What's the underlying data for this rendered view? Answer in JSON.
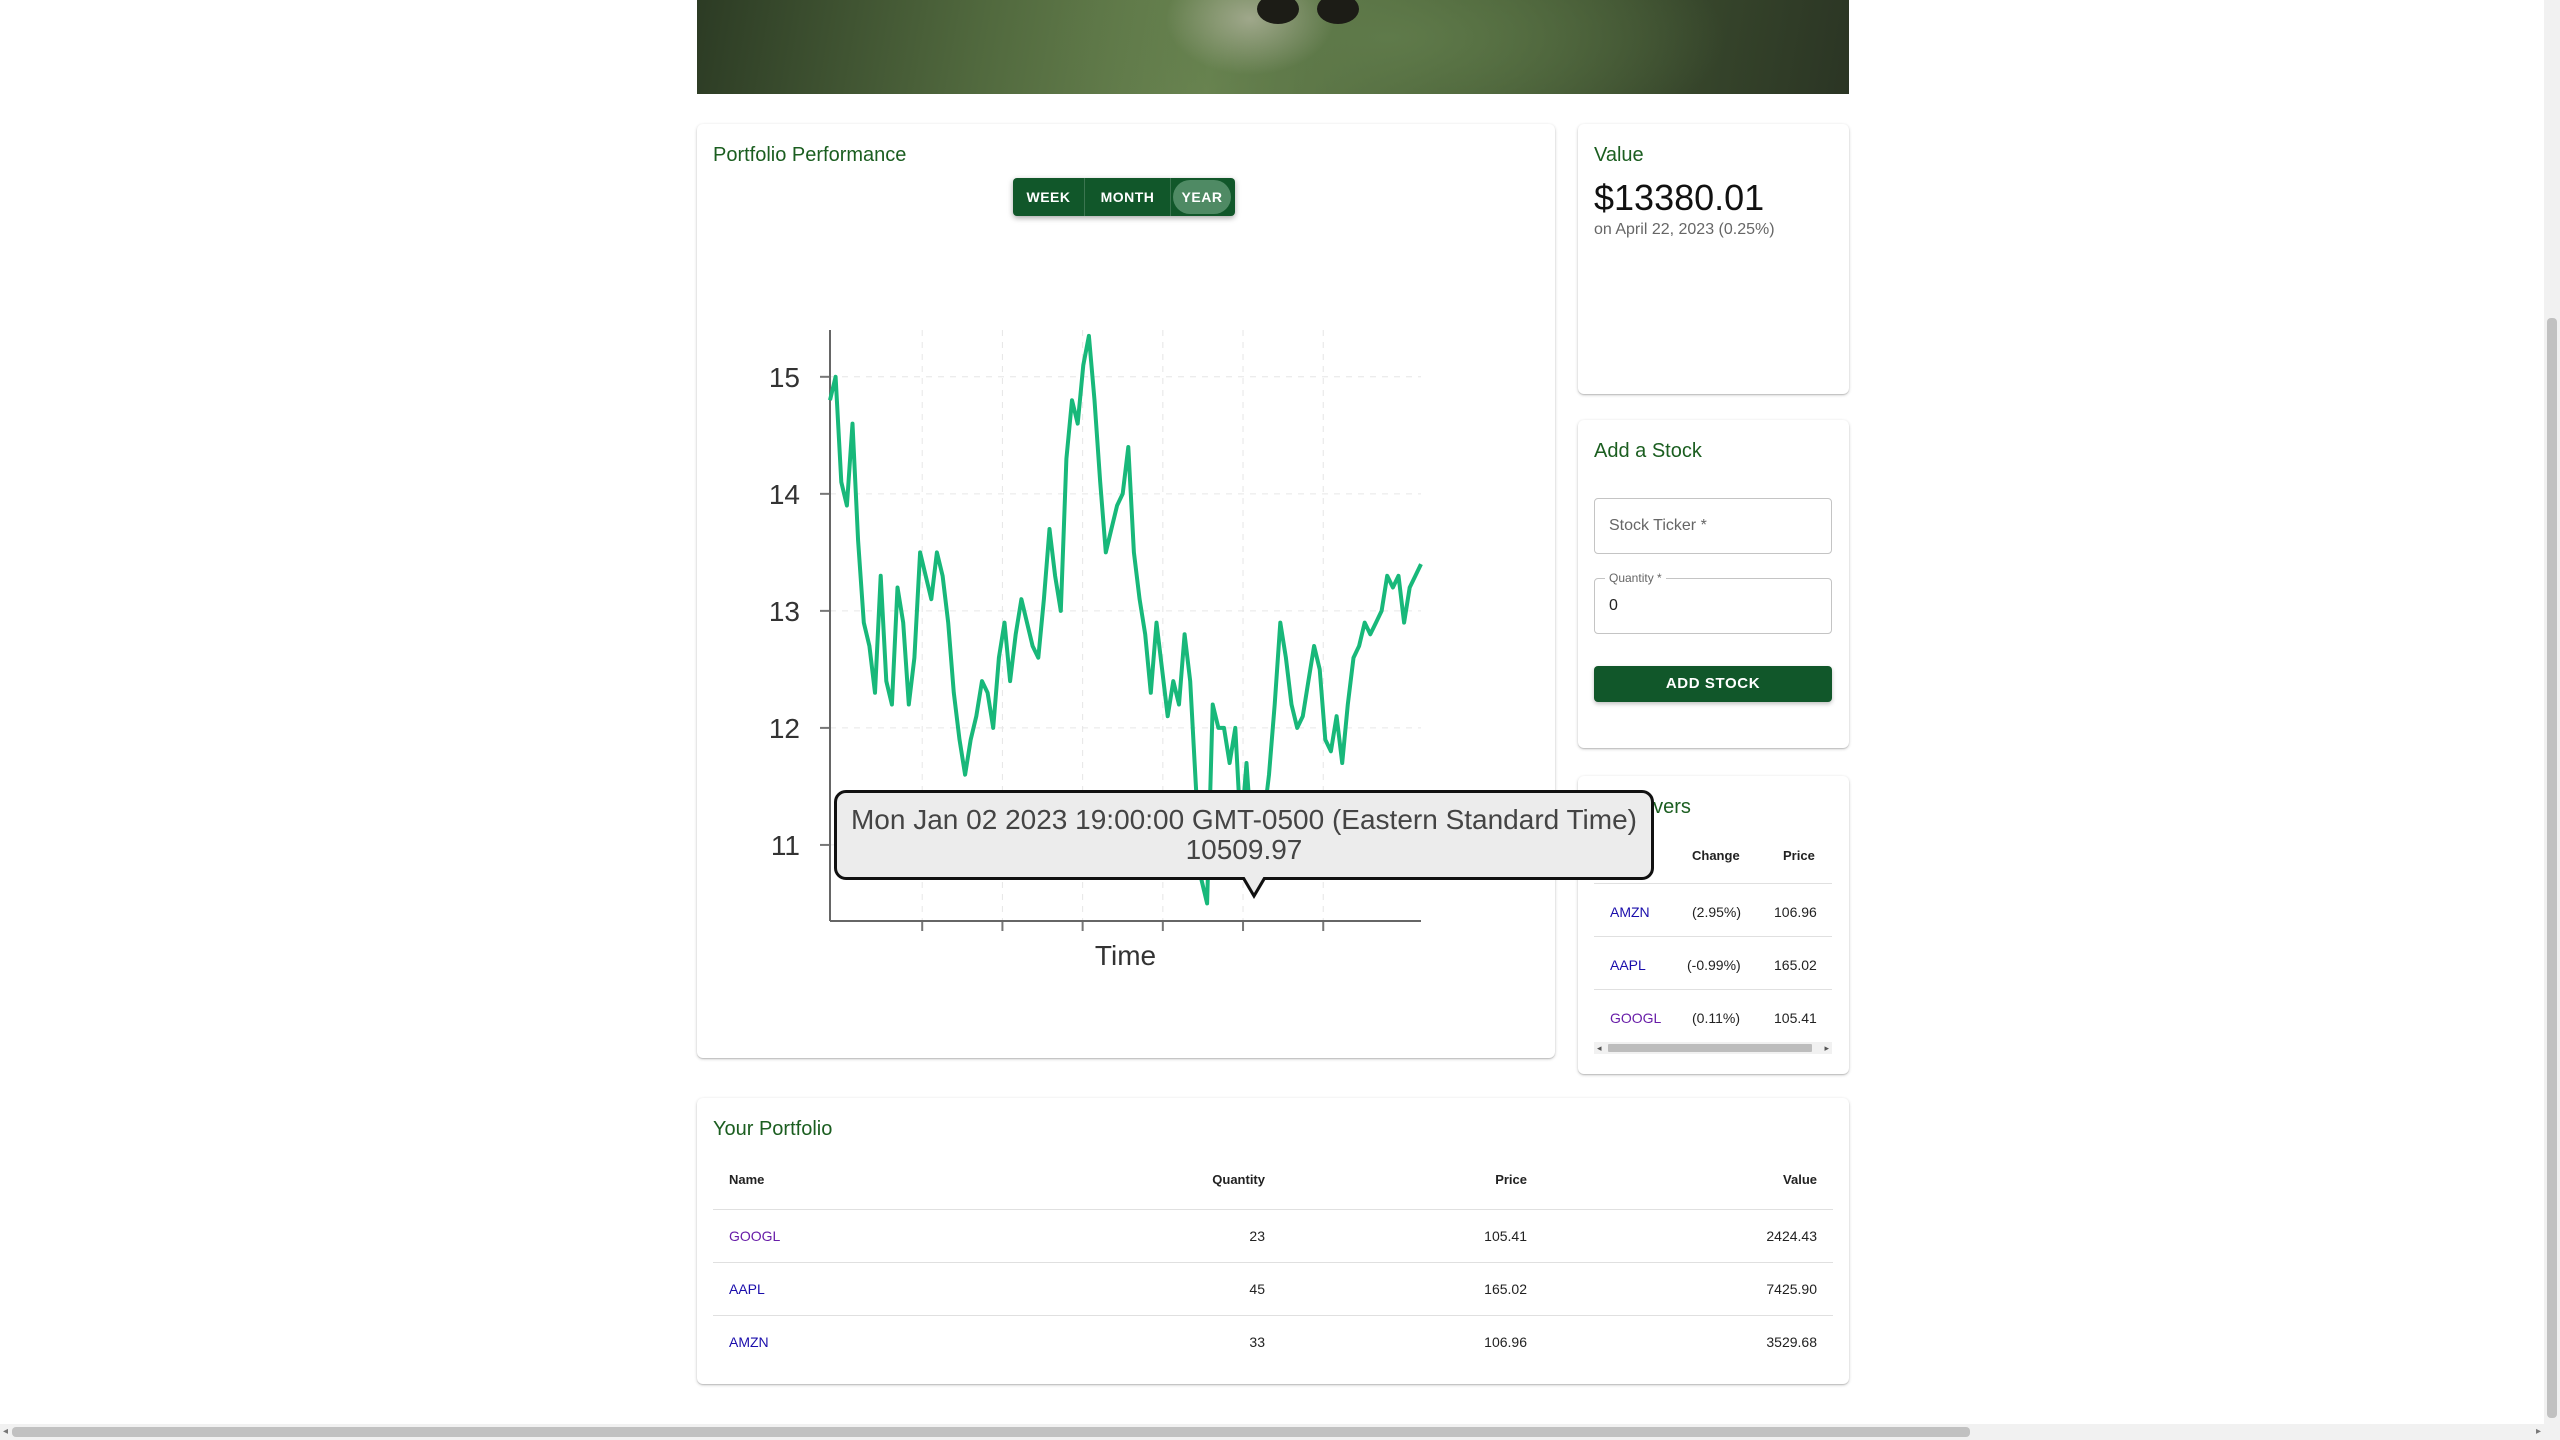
{
  "performance": {
    "title": "Portfolio Performance",
    "ranges": [
      "WEEK",
      "MONTH",
      "YEAR"
    ],
    "selected_range": "YEAR"
  },
  "tooltip": {
    "date": "Mon Jan 02 2023 19:00:00 GMT-0500 (Eastern Standard Time)",
    "value": "10509.97"
  },
  "chart_data": {
    "type": "line",
    "xlabel": "Time",
    "ylabel": "",
    "y_unit": "thousands",
    "ylim": [
      10.35,
      15.4
    ],
    "yticks": [
      "11",
      "12",
      "13",
      "14",
      "15"
    ],
    "xlim": [
      "2022-04-22",
      "2023-04-22"
    ],
    "grid": true,
    "color": "#18b87a",
    "series": [
      {
        "values": [
          14.8,
          15.0,
          14.1,
          13.9,
          14.6,
          13.6,
          12.9,
          12.7,
          12.3,
          13.3,
          12.4,
          12.2,
          13.2,
          12.9,
          12.2,
          12.6,
          13.5,
          13.3,
          13.1,
          13.5,
          13.3,
          12.9,
          12.3,
          11.9,
          11.6,
          11.9,
          12.1,
          12.4,
          12.3,
          12.0,
          12.6,
          12.9,
          12.4,
          12.8,
          13.1,
          12.9,
          12.7,
          12.6,
          13.1,
          13.7,
          13.3,
          13.0,
          14.3,
          14.8,
          14.6,
          15.1,
          15.35,
          14.8,
          14.1,
          13.5,
          13.7,
          13.9,
          14.0,
          14.4,
          13.5,
          13.1,
          12.8,
          12.3,
          12.9,
          12.5,
          12.1,
          12.4,
          12.2,
          12.8,
          12.4,
          11.5,
          10.7,
          10.5,
          12.2,
          12.0,
          12.0,
          11.7,
          12.0,
          11.1,
          11.7,
          11.0,
          10.8,
          11.2,
          11.6,
          12.2,
          12.9,
          12.6,
          12.2,
          12.0,
          12.1,
          12.4,
          12.7,
          12.5,
          11.9,
          11.8,
          12.1,
          11.7,
          12.2,
          12.6,
          12.7,
          12.9,
          12.8,
          12.9,
          13.0,
          13.3,
          13.2,
          13.3,
          12.9,
          13.2,
          13.3,
          13.4
        ]
      }
    ]
  },
  "value_card": {
    "title": "Value",
    "amount": "$13380.01",
    "subtitle": "on April 22, 2023 (0.25%)"
  },
  "add_stock": {
    "title": "Add a Stock",
    "ticker_placeholder": "Stock Ticker *",
    "quantity_label": "Quantity *",
    "quantity_value": "0",
    "button": "ADD STOCK"
  },
  "movers": {
    "title": "Movers",
    "title_visible": "overs",
    "headers": {
      "change": "Change",
      "price": "Price"
    },
    "rows": [
      {
        "ticker": "AMZN",
        "change": "(2.95%)",
        "price": "106.96"
      },
      {
        "ticker": "AAPL",
        "change": "(-0.99%)",
        "price": "165.02"
      },
      {
        "ticker": "GOOGL",
        "change": "(0.11%)",
        "price": "105.41"
      }
    ]
  },
  "portfolio": {
    "title": "Your Portfolio",
    "headers": {
      "name": "Name",
      "quantity": "Quantity",
      "price": "Price",
      "value": "Value"
    },
    "rows": [
      {
        "name": "GOOGL",
        "quantity": "23",
        "price": "105.41",
        "value": "2424.43"
      },
      {
        "name": "AAPL",
        "quantity": "45",
        "price": "165.02",
        "value": "7425.90"
      },
      {
        "name": "AMZN",
        "quantity": "33",
        "price": "106.96",
        "value": "3529.68"
      }
    ]
  },
  "colors": {
    "accent": "#11572a",
    "title_green": "#1b5e20",
    "line": "#18b87a",
    "link": "#1a0dab",
    "visited": "#681da8"
  }
}
